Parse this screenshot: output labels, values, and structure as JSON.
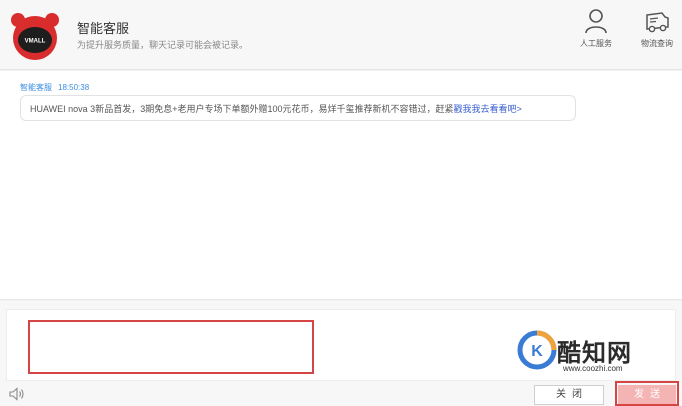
{
  "header": {
    "title": "智能客服",
    "subtitle": "为提升服务质量，聊天记录可能会被记录。",
    "avatar_text": "VMALL",
    "buttons": [
      {
        "label": "人工服务",
        "icon": "person-icon"
      },
      {
        "label": "物流查询",
        "icon": "truck-icon"
      }
    ]
  },
  "chat": {
    "messages": [
      {
        "sender": "智能客服",
        "time": "18:50:38",
        "text": "HUAWEI nova 3新品首发，3期免息+老用户专场下单额外赠100元花币，易烊千玺推荐新机不容错过，赶紧",
        "link_text": "戳我我去看看吧>"
      }
    ]
  },
  "input": {
    "value": "",
    "speaker_icon": "speaker-icon"
  },
  "actions": {
    "close_label": "关闭",
    "send_label": "发送"
  },
  "watermark": {
    "name": "酷知网",
    "url": "www.coozhi.com"
  },
  "colors": {
    "highlight": "#d64545",
    "send": "#f5b4b4",
    "link": "#3a5fd0",
    "meta": "#3a8de0"
  }
}
